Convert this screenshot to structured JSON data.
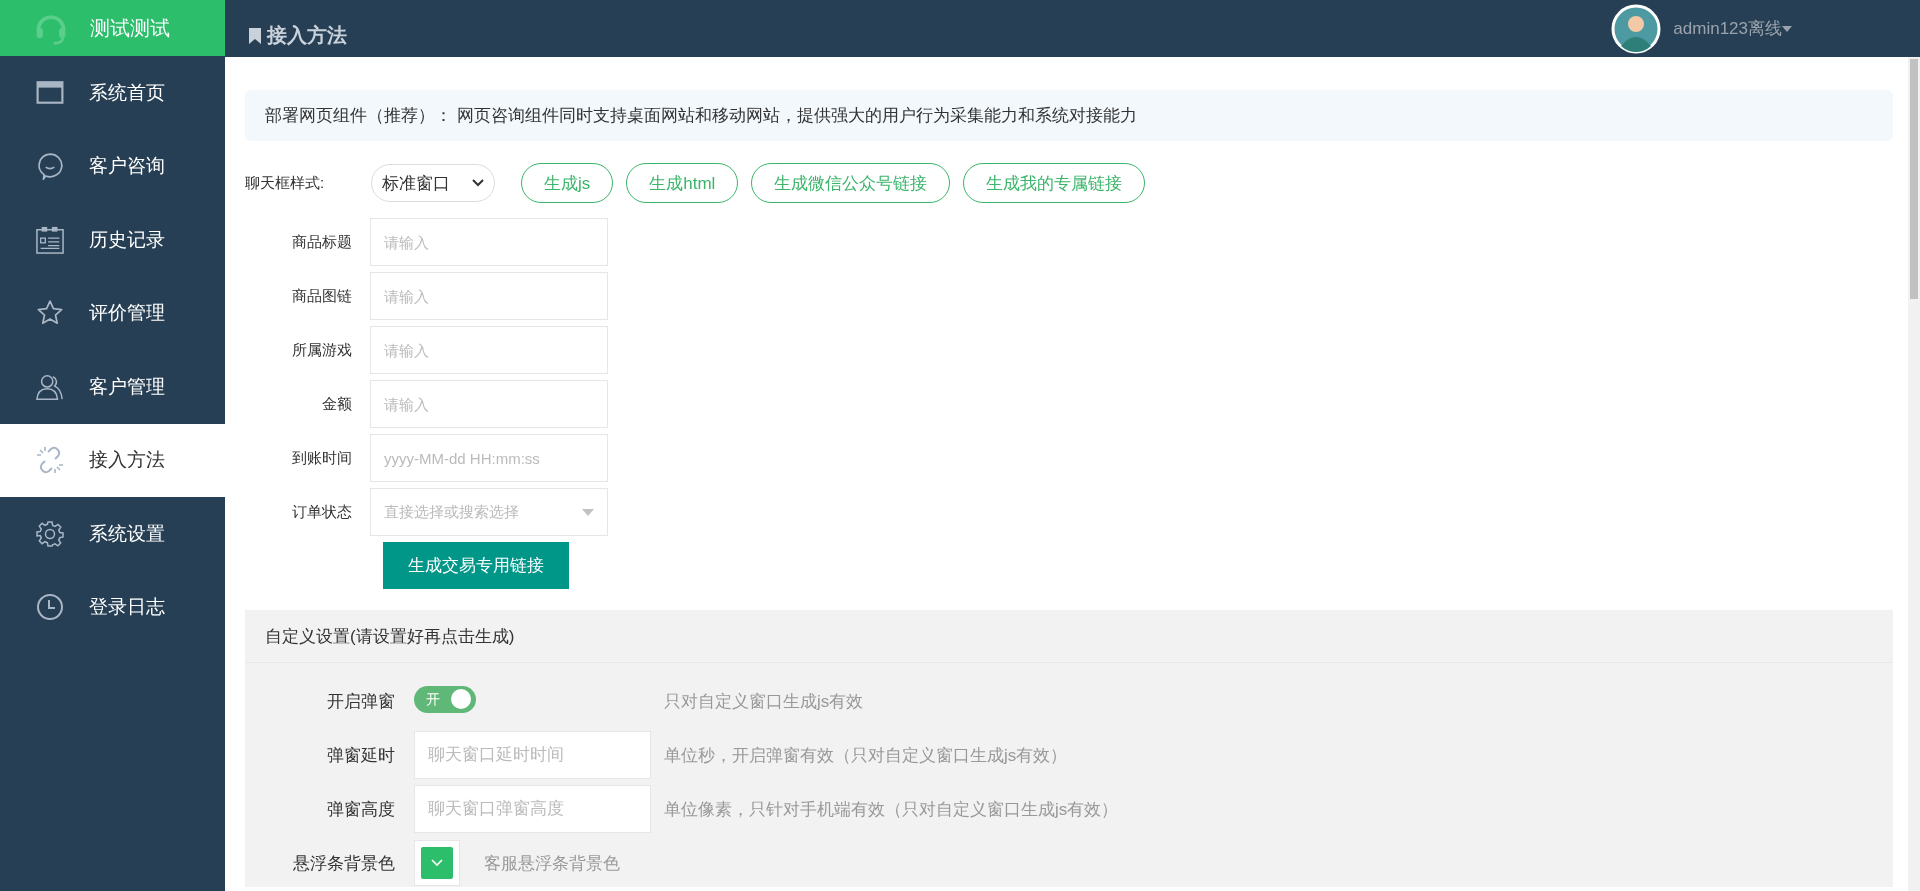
{
  "sidebar": {
    "brand": "测试测试",
    "items": [
      {
        "label": "系统首页",
        "selected": false
      },
      {
        "label": "客户咨询",
        "selected": false
      },
      {
        "label": "历史记录",
        "selected": false
      },
      {
        "label": "评价管理",
        "selected": false
      },
      {
        "label": "客户管理",
        "selected": false
      },
      {
        "label": "接入方法",
        "selected": true
      },
      {
        "label": "系统设置",
        "selected": false
      },
      {
        "label": "登录日志",
        "selected": false
      }
    ]
  },
  "header": {
    "title": "接入方法",
    "user": "admin123离线"
  },
  "notice": "部署网页组件（推荐）： 网页咨询组件同时支持桌面网站和移动网站，提供强大的用户行为采集能力和系统对接能力",
  "chat_style": {
    "label": "聊天框样式:",
    "value": "标准窗口",
    "buttons": [
      "生成js",
      "生成html",
      "生成微信公众号链接",
      "生成我的专属链接"
    ]
  },
  "order_form": {
    "fields": [
      {
        "label": "商品标题",
        "placeholder": "请输入",
        "kind": "text"
      },
      {
        "label": "商品图链",
        "placeholder": "请输入",
        "kind": "text"
      },
      {
        "label": "所属游戏",
        "placeholder": "请输入",
        "kind": "text"
      },
      {
        "label": "金额",
        "placeholder": "请输入",
        "kind": "text"
      },
      {
        "label": "到账时间",
        "placeholder": "yyyy-MM-dd HH:mm:ss",
        "kind": "text"
      },
      {
        "label": "订单状态",
        "placeholder": "直接选择或搜索选择",
        "kind": "select"
      }
    ],
    "submit": "生成交易专用链接"
  },
  "custom_settings": {
    "title": "自定义设置(请设置好再点击生成)",
    "rows": [
      {
        "kind": "switch",
        "label": "开启弹窗",
        "on": true,
        "switch_text": "开",
        "hint": "只对自定义窗口生成js有效"
      },
      {
        "kind": "input",
        "label": "弹窗延时",
        "placeholder": "聊天窗口延时时间",
        "hint": "单位秒，开启弹窗有效（只对自定义窗口生成js有效）"
      },
      {
        "kind": "input",
        "label": "弹窗高度",
        "placeholder": "聊天窗口弹窗高度",
        "hint": "单位像素，只针对手机端有效（只对自定义窗口生成js有效）"
      },
      {
        "kind": "color",
        "label": "悬浮条背景色",
        "color": "#2dbe6c",
        "hint": "客服悬浮条背景色"
      }
    ]
  }
}
